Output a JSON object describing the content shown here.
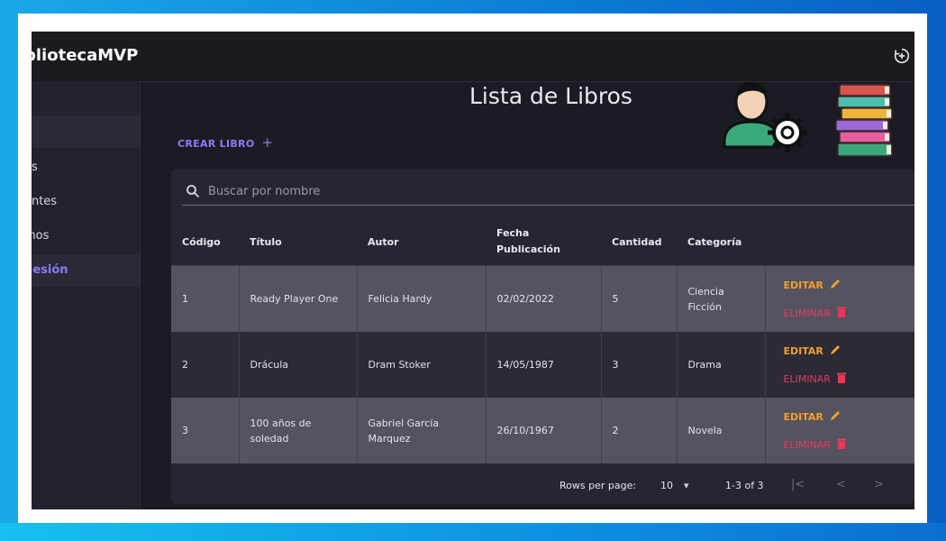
{
  "app": {
    "brand": "bliotecaMVP"
  },
  "sidebar": {
    "items": [
      {
        "label": ""
      },
      {
        "label": "os"
      },
      {
        "label": "antes"
      },
      {
        "label": "mos"
      },
      {
        "label": "Sesión"
      }
    ]
  },
  "main": {
    "title": "Lista de Libros",
    "create_label": "CREAR LIBRO",
    "create_icon": "+"
  },
  "search": {
    "placeholder": "Buscar por nombre"
  },
  "table": {
    "headers": [
      "Código",
      "Título",
      "Autor",
      "Fecha Publicación",
      "Cantidad",
      "Categoría",
      ""
    ],
    "header_fecha_line1": "Fecha",
    "header_fecha_line2": "Publicación",
    "rows": [
      {
        "codigo": "1",
        "titulo": "Ready Player One",
        "autor": "Felicia Hardy",
        "fecha": "02/02/2022",
        "cantidad": "5",
        "categoria": "Ciencia Ficción"
      },
      {
        "codigo": "2",
        "titulo": "Drácula",
        "autor": "Dram Stoker",
        "fecha": "14/05/1987",
        "cantidad": "3",
        "categoria": "Drama"
      },
      {
        "codigo": "3",
        "titulo": "100 años de soledad",
        "autor": "Gabriel García Marquez",
        "fecha": "26/10/1967",
        "cantidad": "2",
        "categoria": "Novela"
      }
    ],
    "edit_label": "EDITAR",
    "delete_label": "ELIMINAR"
  },
  "pagination": {
    "rows_per_page_label": "Rows per page:",
    "rows_per_page_value": "10",
    "range": "1-3 of 3",
    "first": "|<",
    "prev": "<",
    "next": ">"
  },
  "colors": {
    "accent": "#8b7cf6",
    "edit": "#f2a12a",
    "delete": "#e8385e",
    "background": "#1c1b23"
  }
}
